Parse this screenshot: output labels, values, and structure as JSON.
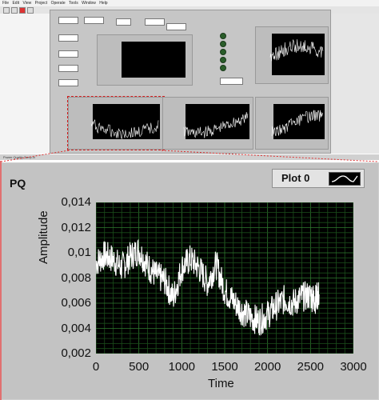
{
  "app": {
    "menu": [
      "File",
      "Edit",
      "View",
      "Project",
      "Operate",
      "Tools",
      "Window",
      "Help"
    ],
    "status_tab": "Power Quality Tamp.vi"
  },
  "legend": {
    "label": "Plot 0"
  },
  "chart_data": {
    "type": "line",
    "title": "PQ",
    "xlabel": "Time",
    "ylabel": "Amplitude",
    "xlim": [
      0,
      3000
    ],
    "ylim": [
      0.002,
      0.014
    ],
    "x_ticks": [
      "0",
      "500",
      "1000",
      "1500",
      "2000",
      "2500",
      "3000"
    ],
    "y_ticks": [
      "0,002",
      "0,004",
      "0,006",
      "0,008",
      "0,01",
      "0,012",
      "0,014"
    ],
    "grid": true,
    "series": [
      {
        "name": "Plot 0",
        "color": "#ffffff",
        "x": [
          0,
          100,
          200,
          300,
          400,
          500,
          600,
          700,
          800,
          900,
          1000,
          1100,
          1200,
          1300,
          1400,
          1500,
          1600,
          1700,
          1800,
          1900,
          2000,
          2100,
          2200,
          2300,
          2400,
          2500,
          2550,
          2600
        ],
        "values": [
          0.0092,
          0.0098,
          0.0095,
          0.0088,
          0.0097,
          0.0102,
          0.009,
          0.0082,
          0.0078,
          0.0064,
          0.0088,
          0.0095,
          0.0088,
          0.0076,
          0.0091,
          0.007,
          0.0062,
          0.0054,
          0.0049,
          0.0046,
          0.0051,
          0.0058,
          0.0063,
          0.006,
          0.0065,
          0.0066,
          0.0063,
          0.0067
        ]
      }
    ]
  }
}
